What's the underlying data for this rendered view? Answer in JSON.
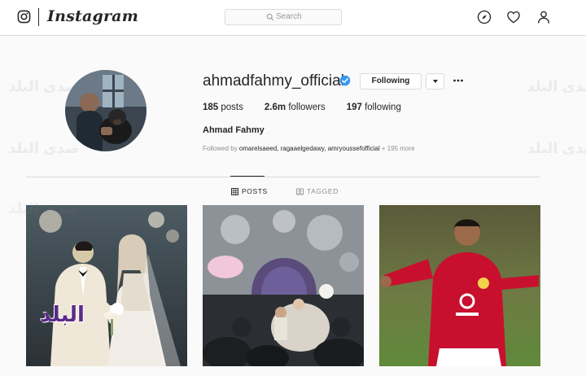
{
  "nav": {
    "wordmark": "Instagram",
    "search_placeholder": "Search"
  },
  "profile": {
    "username": "ahmadfahmy_official",
    "verified": true,
    "follow_button_label": "Following",
    "stats": {
      "posts_count": "185",
      "posts_label": "posts",
      "followers_count": "2.6m",
      "followers_label": "followers",
      "following_count": "197",
      "following_label": "following"
    },
    "full_name": "Ahmad Fahmy",
    "followed_by_prefix": "Followed by",
    "followed_by_names": "omarelsaeed, ragaaelgedawy, amryoussefofficial",
    "followed_by_more": "+ 195 more"
  },
  "tabs": [
    {
      "label": "POSTS",
      "icon": "grid-icon",
      "active": true
    },
    {
      "label": "TAGGED",
      "icon": "tag-icon",
      "active": false
    }
  ],
  "posts": [
    {
      "description": "wedding-couple-photo"
    },
    {
      "description": "wedding-stage-photo"
    },
    {
      "description": "football-player-photo"
    }
  ],
  "watermark": {
    "text": "صدى البلد",
    "logo_text": "البلد"
  },
  "colors": {
    "verified_blue": "#3897f0",
    "jersey_red": "#c8102e",
    "watermark_purple": "#5b2a86"
  }
}
